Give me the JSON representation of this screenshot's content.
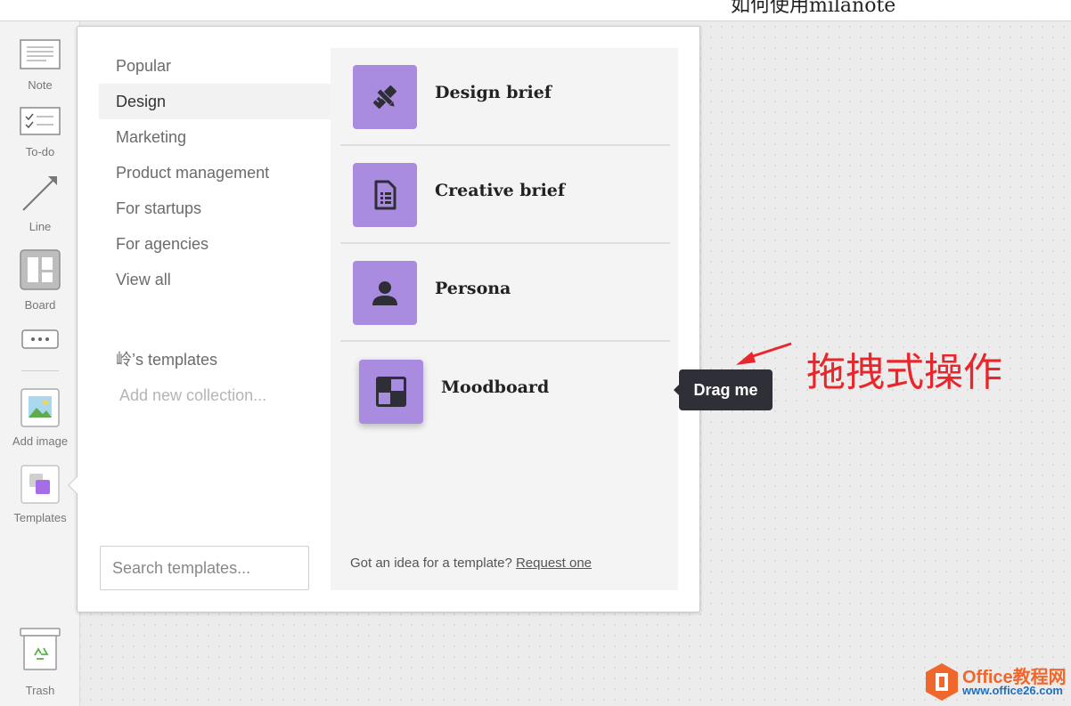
{
  "topbar": {
    "title": "如何使用milanote"
  },
  "toolbar": {
    "note": "Note",
    "todo": "To-do",
    "line": "Line",
    "board": "Board",
    "add_image": "Add image",
    "templates": "Templates",
    "trash": "Trash"
  },
  "categories": [
    "Popular",
    "Design",
    "Marketing",
    "Product management",
    "For startups",
    "For agencies",
    "View all"
  ],
  "active_category": "Design",
  "collections": {
    "my_templates": "岭’s templates",
    "add_new": "Add new collection..."
  },
  "search": {
    "placeholder": "Search templates..."
  },
  "templates": [
    {
      "name": "Design brief",
      "icon": "pencil-ruler-icon"
    },
    {
      "name": "Creative brief",
      "icon": "document-icon"
    },
    {
      "name": "Persona",
      "icon": "person-icon"
    },
    {
      "name": "Moodboard",
      "icon": "moodboard-icon"
    }
  ],
  "footer": {
    "text": "Got an idea for a template? ",
    "link": "Request one"
  },
  "tooltip": {
    "label": "Drag me"
  },
  "annotation": {
    "text": "拖拽式操作"
  },
  "watermark": {
    "brand": "Office教程网",
    "url": "www.office26.com"
  },
  "colors": {
    "accent": "#a98be0",
    "annotation_red": "#e8262b",
    "tooltip_bg": "#2f2f38"
  }
}
